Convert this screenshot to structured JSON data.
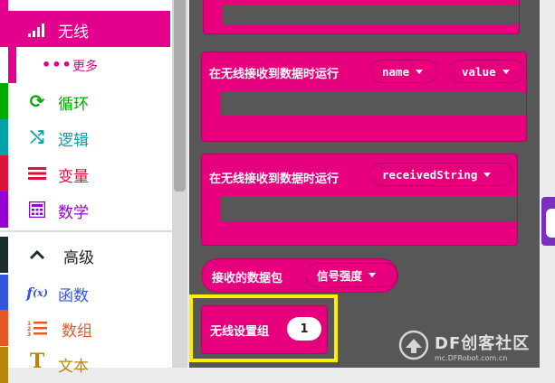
{
  "toolbox": {
    "categories": [
      {
        "key": "radio",
        "label": "无线",
        "icon": "signal-bars-icon",
        "color": "#e3008c",
        "selected": true
      },
      {
        "key": "more",
        "label": "更多",
        "icon": "ellipsis-icon",
        "color": "#e3008c"
      },
      {
        "key": "loops",
        "label": "循环",
        "icon": "loop-arrow-icon",
        "color": "#00aa00"
      },
      {
        "key": "logic",
        "label": "逻辑",
        "icon": "shuffle-icon",
        "color": "#00a4a6"
      },
      {
        "key": "variables",
        "label": "变量",
        "icon": "list-lines-icon",
        "color": "#dc143c"
      },
      {
        "key": "math",
        "label": "数学",
        "icon": "calculator-icon",
        "color": "#9400d3"
      },
      {
        "key": "advanced",
        "label": "高级",
        "icon": "chevron-up-icon",
        "color": "#1c2f2f"
      },
      {
        "key": "functions",
        "label": "函数",
        "icon": "function-icon",
        "color": "#3455db"
      },
      {
        "key": "arrays",
        "label": "数组",
        "icon": "numbered-list-icon",
        "color": "#e65722"
      },
      {
        "key": "text",
        "label": "文本",
        "icon": "text-t-icon",
        "color": "#b8860b"
      }
    ]
  },
  "blocks": {
    "on_received_1": {
      "label": "在无线接收到数据时运行",
      "param1": "name",
      "param2": "value"
    },
    "on_received_2": {
      "label": "在无线接收到数据时运行",
      "param1": "receivedString"
    },
    "packet": {
      "label": "接收的数据包",
      "property": "信号强度"
    },
    "set_group": {
      "label": "无线设置组",
      "value": "1"
    }
  },
  "highlight_color": "#ffee00",
  "watermark": {
    "text": "DF创客社区",
    "subtext": "mc.DFRobot.com.cn"
  }
}
